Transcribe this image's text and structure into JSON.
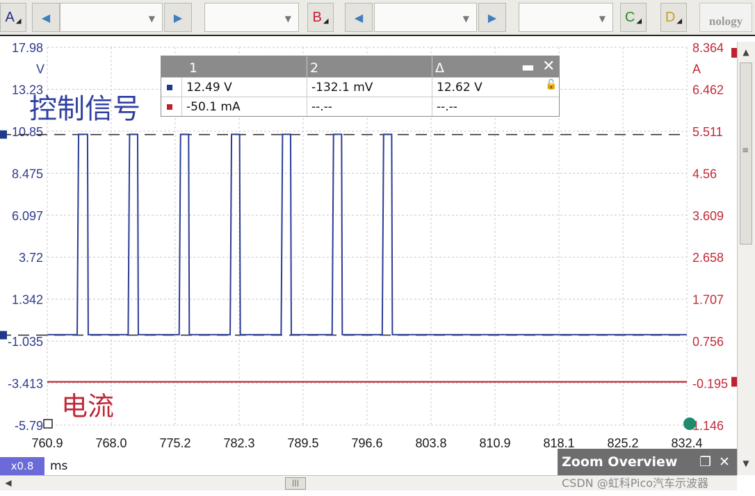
{
  "toolbar": {
    "channel_a": "A",
    "channel_b": "B",
    "channel_c": "C",
    "channel_d": "D",
    "logo_text": "nology",
    "colors": {
      "a": "#1f2f80",
      "b": "#c02030",
      "c": "#2e8a2e",
      "d": "#c8a020",
      "arrow": "#3f7fc1"
    }
  },
  "overlay": {
    "control_signal_label": "控制信号",
    "current_label": "电流"
  },
  "measurements": {
    "headers": [
      "1",
      "2",
      "Δ"
    ],
    "rows": [
      {
        "swatch_color": "#1f3a8a",
        "v1": "12.49 V",
        "v2": "-132.1 mV",
        "delta": "12.62 V"
      },
      {
        "swatch_color": "#c02030",
        "v1": "-50.1 mA",
        "v2": "--.--",
        "delta": "--.--"
      }
    ]
  },
  "statusbar": {
    "zoom": "x0.8",
    "units": "ms"
  },
  "zoom_overview": {
    "title": "Zoom Overview"
  },
  "watermark": "CSDN @虹科Pico汽车示波器",
  "chart_data": {
    "type": "line",
    "x_unit": "ms",
    "x_ticks": [
      "760.9",
      "768.0",
      "775.2",
      "782.3",
      "789.5",
      "796.6",
      "803.8",
      "810.9",
      "818.1",
      "825.2",
      "832.4"
    ],
    "xlim": [
      760.9,
      832.4
    ],
    "left_axis": {
      "unit": "V",
      "ticks": [
        "17.98",
        "13.23",
        "10.85",
        "8.475",
        "6.097",
        "3.72",
        "1.342",
        "-1.035",
        "-3.413",
        "-5.79"
      ],
      "ylim": [
        -5.79,
        17.98
      ],
      "color": "#2e3a8c"
    },
    "right_axis": {
      "unit": "A",
      "ticks": [
        "8.364",
        "6.462",
        "5.511",
        "4.56",
        "3.609",
        "2.658",
        "1.707",
        "0.756",
        "-0.195",
        "1.146"
      ],
      "color": "#c02a38"
    },
    "series": [
      {
        "name": "控制信号",
        "color": "#2a3c94",
        "low_value": -0.1,
        "high_value": 12.5,
        "high_pulses_ms": [
          [
            764.4,
            765.4
          ],
          [
            770.1,
            771.0
          ],
          [
            775.8,
            776.7
          ],
          [
            781.5,
            782.4
          ],
          [
            787.2,
            788.1
          ],
          [
            792.9,
            793.8
          ],
          [
            798.5,
            799.4
          ]
        ]
      },
      {
        "name": "电流",
        "color": "#c02a38",
        "value": -0.05
      }
    ],
    "cursor_levels": [
      {
        "axis": "left",
        "value": 12.49
      },
      {
        "axis": "left",
        "value": -0.13
      }
    ],
    "grid": true
  }
}
